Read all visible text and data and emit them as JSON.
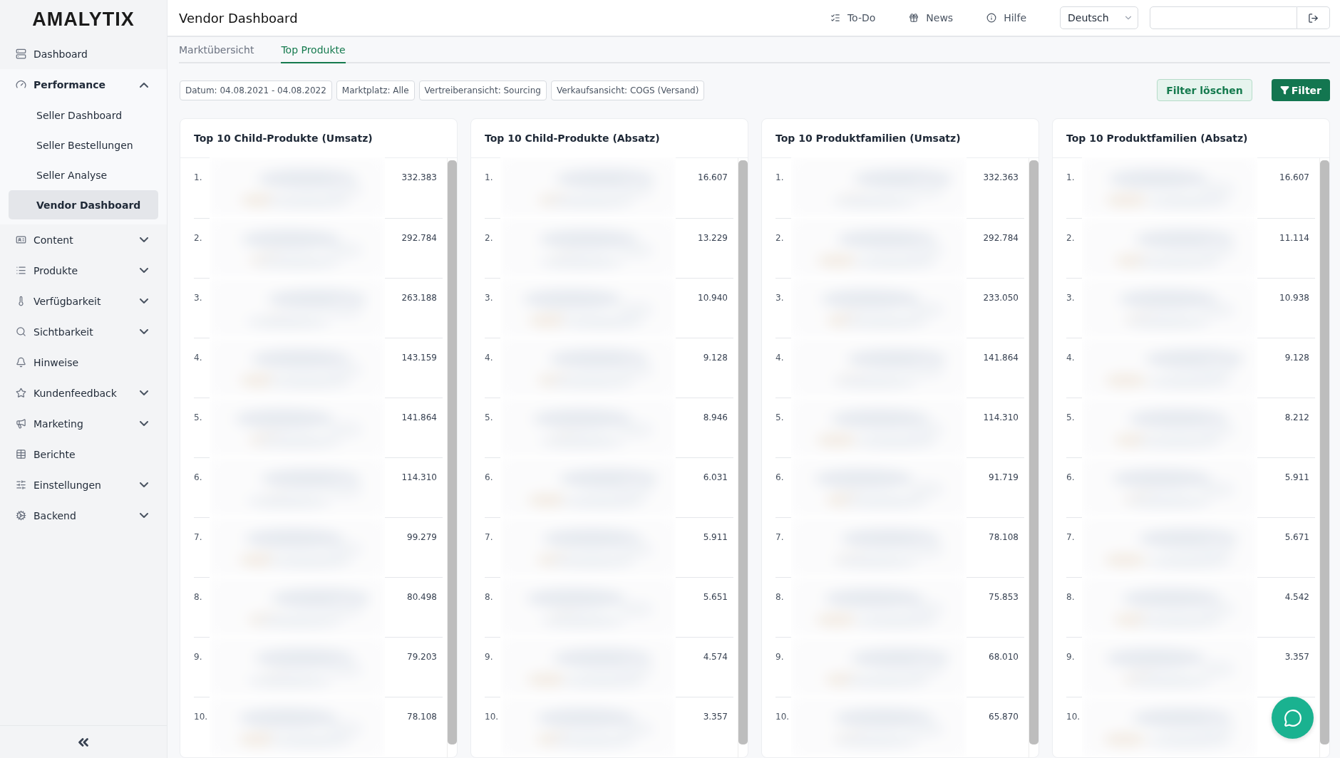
{
  "logo": "AMALYTIX",
  "sidebar": {
    "items": [
      {
        "label": "Dashboard",
        "kind": "link"
      },
      {
        "label": "Performance",
        "kind": "group",
        "expanded": true,
        "children": [
          {
            "label": "Seller Dashboard",
            "selected": false
          },
          {
            "label": "Seller Bestellungen",
            "selected": false
          },
          {
            "label": "Seller Analyse",
            "selected": false
          },
          {
            "label": "Vendor Dashboard",
            "selected": true
          }
        ]
      },
      {
        "label": "Content",
        "kind": "group",
        "expanded": false
      },
      {
        "label": "Produkte",
        "kind": "group",
        "expanded": false
      },
      {
        "label": "Verfügbarkeit",
        "kind": "group",
        "expanded": false
      },
      {
        "label": "Sichtbarkeit",
        "kind": "group",
        "expanded": false
      },
      {
        "label": "Hinweise",
        "kind": "link"
      },
      {
        "label": "Kundenfeedback",
        "kind": "group",
        "expanded": false
      },
      {
        "label": "Marketing",
        "kind": "group",
        "expanded": false
      },
      {
        "label": "Berichte",
        "kind": "link"
      },
      {
        "label": "Einstellungen",
        "kind": "group",
        "expanded": false
      },
      {
        "label": "Backend",
        "kind": "group",
        "expanded": false
      }
    ]
  },
  "header": {
    "title": "Vendor Dashboard",
    "links": [
      "To-Do",
      "News",
      "Hilfe"
    ],
    "language": "Deutsch"
  },
  "tabs": [
    {
      "label": "Marktübersicht",
      "selected": false
    },
    {
      "label": "Top Produkte",
      "selected": true
    }
  ],
  "filters": [
    "Datum: 04.08.2021 - 04.08.2022",
    "Marktplatz: Alle",
    "Vertreiberansicht: Sourcing",
    "Verkaufsansicht: COGS (Versand)"
  ],
  "buttons": {
    "clear": "Filter löschen",
    "filter": "Filter"
  },
  "cards": [
    {
      "title": "Top 10 Child-Produkte (Umsatz)",
      "rows": [
        {
          "rank": "1.",
          "value": "332.383"
        },
        {
          "rank": "2.",
          "value": "292.784"
        },
        {
          "rank": "3.",
          "value": "263.188"
        },
        {
          "rank": "4.",
          "value": "143.159"
        },
        {
          "rank": "5.",
          "value": "141.864"
        },
        {
          "rank": "6.",
          "value": "114.310"
        },
        {
          "rank": "7.",
          "value": "99.279"
        },
        {
          "rank": "8.",
          "value": "80.498"
        },
        {
          "rank": "9.",
          "value": "79.203"
        },
        {
          "rank": "10.",
          "value": "78.108"
        }
      ]
    },
    {
      "title": "Top 10 Child-Produkte (Absatz)",
      "rows": [
        {
          "rank": "1.",
          "value": "16.607"
        },
        {
          "rank": "2.",
          "value": "13.229"
        },
        {
          "rank": "3.",
          "value": "10.940"
        },
        {
          "rank": "4.",
          "value": "9.128"
        },
        {
          "rank": "5.",
          "value": "8.946"
        },
        {
          "rank": "6.",
          "value": "6.031"
        },
        {
          "rank": "7.",
          "value": "5.911"
        },
        {
          "rank": "8.",
          "value": "5.651"
        },
        {
          "rank": "9.",
          "value": "4.574"
        },
        {
          "rank": "10.",
          "value": "3.357"
        }
      ]
    },
    {
      "title": "Top 10 Produktfamilien (Umsatz)",
      "rows": [
        {
          "rank": "1.",
          "value": "332.363"
        },
        {
          "rank": "2.",
          "value": "292.784"
        },
        {
          "rank": "3.",
          "value": "233.050"
        },
        {
          "rank": "4.",
          "value": "141.864"
        },
        {
          "rank": "5.",
          "value": "114.310"
        },
        {
          "rank": "6.",
          "value": "91.719"
        },
        {
          "rank": "7.",
          "value": "78.108"
        },
        {
          "rank": "8.",
          "value": "75.853"
        },
        {
          "rank": "9.",
          "value": "68.010"
        },
        {
          "rank": "10.",
          "value": "65.870"
        }
      ]
    },
    {
      "title": "Top 10 Produktfamilien (Absatz)",
      "rows": [
        {
          "rank": "1.",
          "value": "16.607"
        },
        {
          "rank": "2.",
          "value": "11.114"
        },
        {
          "rank": "3.",
          "value": "10.938"
        },
        {
          "rank": "4.",
          "value": "9.128"
        },
        {
          "rank": "5.",
          "value": "8.212"
        },
        {
          "rank": "6.",
          "value": "5.911"
        },
        {
          "rank": "7.",
          "value": "5.671"
        },
        {
          "rank": "8.",
          "value": "4.542"
        },
        {
          "rank": "9.",
          "value": "3.357"
        },
        {
          "rank": "10."
        }
      ]
    }
  ]
}
